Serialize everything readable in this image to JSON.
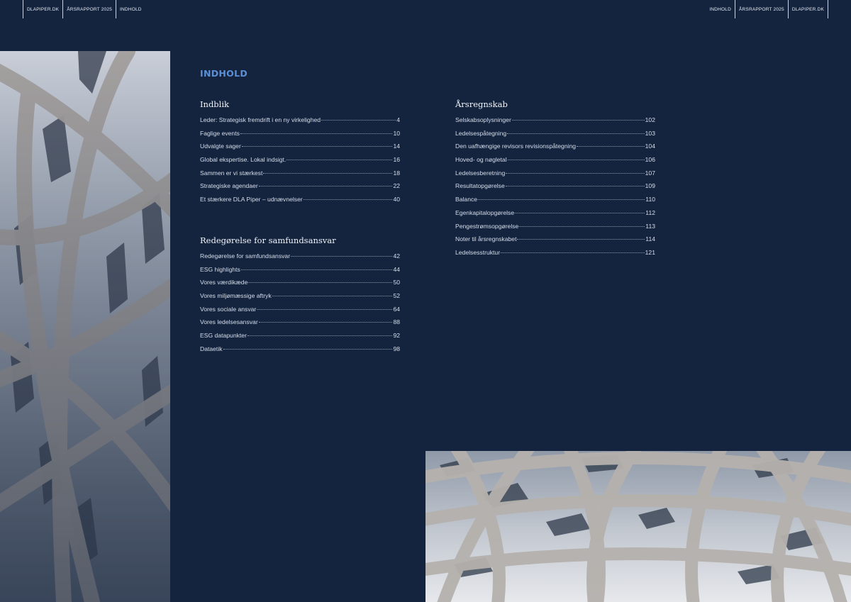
{
  "nav_left": [
    "DLAPIPER.DK",
    "ÅRSRAPPORT 2025",
    "INDHOLD"
  ],
  "nav_right": [
    "INDHOLD",
    "ÅRSRAPPORT 2025",
    "DLAPIPER.DK"
  ],
  "page_heading": "INDHOLD",
  "sections": [
    {
      "title": "Indblik",
      "items": [
        {
          "label": "Leder: Strategisk fremdrift i en ny virkelighed",
          "page": "4"
        },
        {
          "label": "Faglige events",
          "page": "10"
        },
        {
          "label": "Udvalgte sager",
          "page": "14"
        },
        {
          "label": "Global ekspertise. Lokal indsigt.",
          "page": "16"
        },
        {
          "label": "Sammen er vi stærkest",
          "page": "18"
        },
        {
          "label": "Strategiske agendaer",
          "page": "22"
        },
        {
          "label": "Et stærkere DLA Piper – udnævnelser",
          "page": "40"
        }
      ]
    },
    {
      "title": "Redegørelse for samfundsansvar",
      "items": [
        {
          "label": "Redegørelse for samfundsansvar",
          "page": "42"
        },
        {
          "label": "ESG highlights",
          "page": "44"
        },
        {
          "label": "Vores værdikæde",
          "page": "50"
        },
        {
          "label": "Vores miljømæssige aftryk",
          "page": "52"
        },
        {
          "label": "Vores sociale ansvar",
          "page": "64"
        },
        {
          "label": "Vores ledelsesansvar",
          "page": "88"
        },
        {
          "label": "ESG datapunkter",
          "page": "92"
        },
        {
          "label": "Dataetik",
          "page": "98"
        }
      ]
    },
    {
      "title": "Årsregnskab",
      "items": [
        {
          "label": "Selskabsoplysninger",
          "page": "102"
        },
        {
          "label": "Ledelsespåtegning",
          "page": "103"
        },
        {
          "label": "Den uafhængige revisors revisionspåtegning",
          "page": "104"
        },
        {
          "label": "Hoved- og nøgletal",
          "page": "106"
        },
        {
          "label": "Ledelsesberetning",
          "page": "107"
        },
        {
          "label": "Resultatopgørelse",
          "page": "109"
        },
        {
          "label": "Balance",
          "page": "110"
        },
        {
          "label": "Egenkapitalopgørelse",
          "page": "112"
        },
        {
          "label": "Pengestrømsopgørelse",
          "page": "113"
        },
        {
          "label": "Noter til årsregnskabet",
          "page": "114"
        },
        {
          "label": "Ledelsesstruktur",
          "page": "121"
        }
      ]
    }
  ],
  "colors": {
    "background": "#14243f",
    "accent": "#5b8fd6"
  },
  "images": [
    "architecture-ceiling-photo-left",
    "architecture-ceiling-photo-bottom"
  ]
}
